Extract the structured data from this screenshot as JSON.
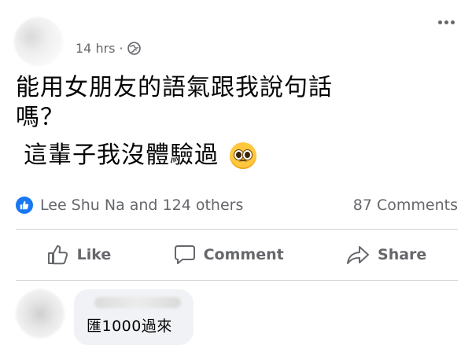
{
  "post": {
    "timestamp": "14 hrs",
    "separator": "·",
    "audience_icon": "globe-icon",
    "more_icon": "more-options-icon",
    "text_line1": "能用女朋友的語氣跟我說句話",
    "text_line2": "嗎？",
    "text_line3": "這輩子我沒體驗過",
    "emoji": "pleading-face-emoji"
  },
  "reactions": {
    "summary": "Lee Shu Na and 124 others",
    "comments_count": "87 Comments",
    "reaction_icon": "like-reaction-icon"
  },
  "actions": {
    "like_label": "Like",
    "comment_label": "Comment",
    "share_label": "Share"
  },
  "comment": {
    "text": "匯1000過來"
  },
  "colors": {
    "brand_blue": "#1877f2",
    "secondary_text": "#65676b",
    "primary_text": "#050505",
    "bubble_bg": "#f0f2f5",
    "divider": "#ced0d4"
  }
}
